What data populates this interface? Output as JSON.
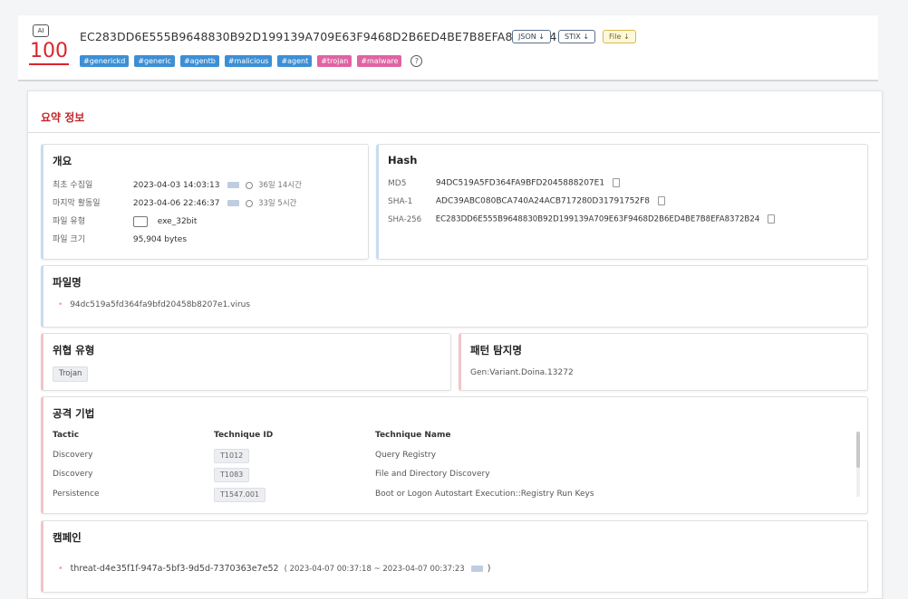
{
  "header": {
    "ai_badge": "AI",
    "score": "100",
    "hash": "EC283DD6E555B9648830B92D199139A709E63F9468D2B6ED4BE7B8EFA8372B24",
    "downloads": [
      {
        "label": "JSON ↓"
      },
      {
        "label": "STIX ↓"
      },
      {
        "label": "File ↓"
      }
    ],
    "tags": [
      {
        "label": "#generickd",
        "color": "blue"
      },
      {
        "label": "#generic",
        "color": "blue"
      },
      {
        "label": "#agentb",
        "color": "blue"
      },
      {
        "label": "#malicious",
        "color": "blue"
      },
      {
        "label": "#agent",
        "color": "blue"
      },
      {
        "label": "#trojan",
        "color": "pink"
      },
      {
        "label": "#malware",
        "color": "pink"
      }
    ],
    "help_glyph": "?"
  },
  "summary": {
    "title": "요약 정보"
  },
  "overview": {
    "title": "개요",
    "first_collected_label": "최초 수집일",
    "first_collected_value": "2023-04-03 14:03:13",
    "first_collected_elapsed": "36일 14시간",
    "last_active_label": "마지막 활동일",
    "last_active_value": "2023-04-06 22:46:37",
    "last_active_elapsed": "33일 5시간",
    "file_type_label": "파일 유형",
    "file_type_value": "exe_32bit",
    "file_size_label": "파일 크기",
    "file_size_value": "95,904 bytes"
  },
  "hash": {
    "title": "Hash",
    "md5_label": "MD5",
    "md5_value": "94DC519A5FD364FA9BFD2045888207E1",
    "sha1_label": "SHA-1",
    "sha1_value": "ADC39ABC080BCA740A24ACB717280D31791752F8",
    "sha256_label": "SHA-256",
    "sha256_value": "EC283DD6E555B9648830B92D199139A709E63F9468D2B6ED4BE7B8EFA8372B24"
  },
  "filename": {
    "title": "파일명",
    "value": "94dc519a5fd364fa9bfd20458b8207e1.virus"
  },
  "threat_type": {
    "title": "위협 유형",
    "value": "Trojan"
  },
  "pattern": {
    "title": "패턴 탐지명",
    "value": "Gen:Variant.Doina.13272"
  },
  "attack": {
    "title": "공격 기법",
    "headers": [
      "Tactic",
      "Technique ID",
      "Technique Name"
    ],
    "rows": [
      [
        "Discovery",
        "T1012",
        "Query Registry"
      ],
      [
        "Discovery",
        "T1083",
        "File and Directory Discovery"
      ],
      [
        "Persistence",
        "T1547.001",
        "Boot or Logon Autostart Execution::Registry Run Keys"
      ]
    ]
  },
  "campaign": {
    "title": "캠페인",
    "name": "threat-d4e35f1f-947a-5bf3-9d5d-7370363e7e52",
    "range": "( 2023-04-07 00:37:18 ~ 2023-04-07 00:37:23",
    "close": ")"
  }
}
